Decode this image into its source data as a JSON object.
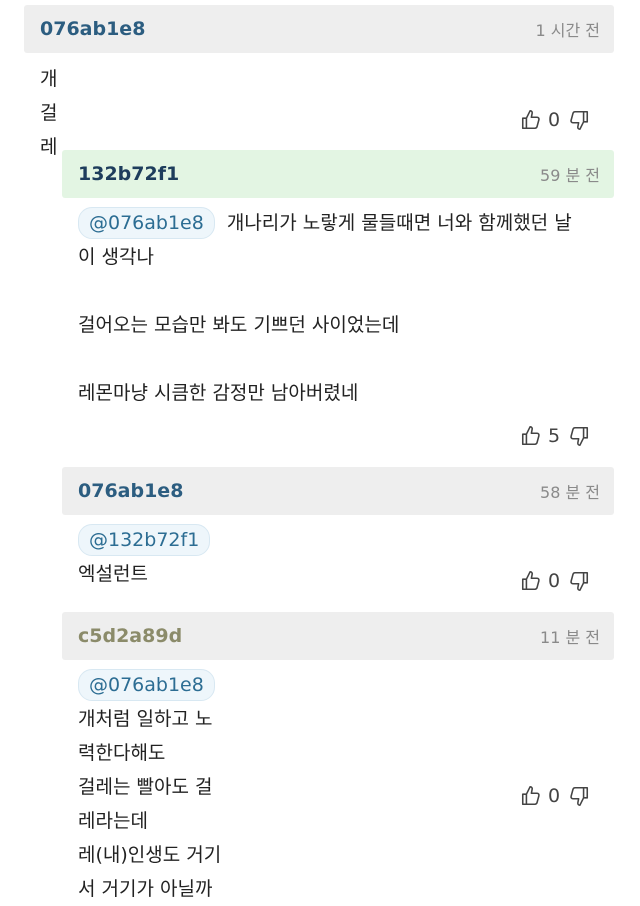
{
  "comments": [
    {
      "author": "076ab1e8",
      "time": "1 시간 전",
      "lines": [
        "개걸레"
      ],
      "votes": "0",
      "header_bg": "#eeeeee",
      "author_color": "#2c5d80"
    },
    {
      "author": "132b72f1",
      "time": "59 분 전",
      "mention": "@076ab1e8",
      "lines": [
        "개나리가 노랗게 물들때면 너와 함께했던 날",
        "이 생각나",
        "",
        "걸어오는 모습만 봐도 기쁘던 사이었는데",
        "",
        "레몬마냥 시큼한 감정만 남아버렸네"
      ],
      "votes": "5",
      "header_bg": "#e3f5e3",
      "author_color": "#1e3d5c"
    },
    {
      "author": "076ab1e8",
      "time": "58 분 전",
      "mention": "@132b72f1",
      "lines": [
        "엑설런트"
      ],
      "votes": "0",
      "header_bg": "#eeeeee",
      "author_color": "#2c5d80"
    },
    {
      "author": "c5d2a89d",
      "time": "11 분 전",
      "mention": "@076ab1e8",
      "lines": [
        "개처럼 일하고 노력한다해도",
        "걸레는 빨아도 걸레라는데",
        "레(내)인생도 거기서 거기가 아닐까"
      ],
      "votes": "0",
      "header_bg": "#eeeeee",
      "author_color": "#8b8b6a"
    }
  ],
  "icons": {
    "like": "thumbs-up-icon",
    "dislike": "thumbs-down-icon"
  }
}
